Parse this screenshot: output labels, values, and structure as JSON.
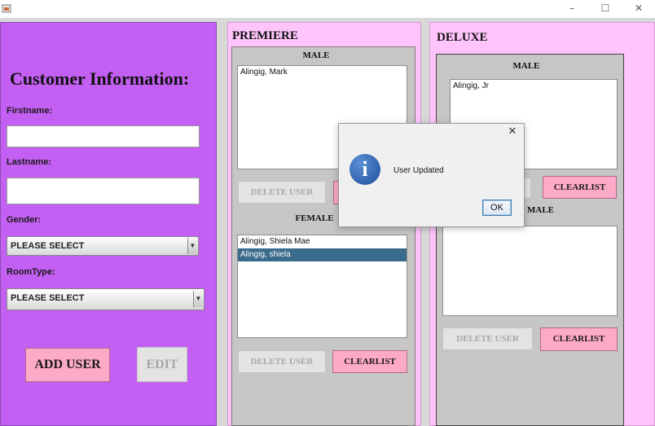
{
  "window": {
    "minimize": "–",
    "maximize": "☐",
    "close": "✕"
  },
  "customer_form": {
    "heading": "Customer Information:",
    "firstname_label": "Firstname:",
    "firstname_value": "",
    "lastname_label": "Lastname:",
    "lastname_value": "",
    "gender_label": "Gender:",
    "gender_value": "PLEASE SELECT",
    "roomtype_label": "RoomType:",
    "roomtype_value": "PLEASE SELECT",
    "add_user_label": "ADD USER",
    "edit_label": "EDIT"
  },
  "premiere": {
    "title": "PREMIERE",
    "male_title": "MALE",
    "male_list": [
      "Alingig, Mark"
    ],
    "male_delete_label": "DELETE USER",
    "female_title": "FEMALE",
    "female_list": [
      "Alingig, Shiela Mae",
      "Alingig, shiela"
    ],
    "female_selected_index": 1,
    "female_delete_label": "DELETE USER",
    "female_clearlist_label": "CLEARLIST"
  },
  "deluxe": {
    "title": "DELUXE",
    "male_title": "MALE",
    "male_list": [
      "Alingig, Jr"
    ],
    "male_clearlist_label": "CLEARLIST",
    "female_title_partial": "MALE",
    "female_list": [],
    "female_delete_label": "DELETE USER",
    "female_clearlist_label": "CLEARLIST"
  },
  "dialog": {
    "message": "User Updated",
    "ok_label": "OK",
    "close": "✕",
    "icon": "info-icon"
  },
  "colors": {
    "left_panel": "#c35ff2",
    "room_panel": "#ffc4fb",
    "pink_button": "#fda9c8",
    "selection": "#3a6a8c"
  }
}
